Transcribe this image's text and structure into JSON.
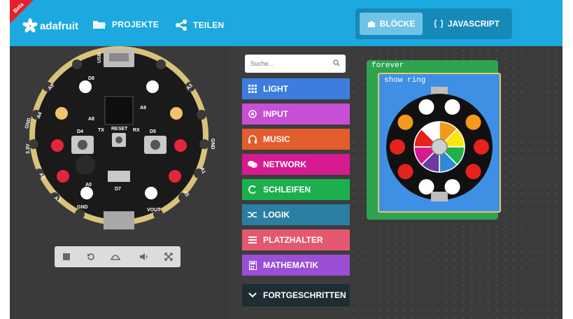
{
  "header": {
    "badge": "Beta",
    "brand": "adafruit",
    "projects_label": "PROJEKTE",
    "share_label": "TEILEN",
    "blocks_label": "BLÖCKE",
    "javascript_label": "JAVASCRIPT"
  },
  "colors": {
    "header": "#1ca9e0",
    "blocks_tab": "#6ec4e6",
    "workspace": "#3b3b3b"
  },
  "simulator": {
    "board_labels": {
      "d8": "D8",
      "d4": "D4",
      "d5": "D5",
      "tx": "TX",
      "rx": "RX",
      "reset": "RESET",
      "a9": "A9",
      "a8": "A8",
      "a0": "A0",
      "d7": "D7",
      "gnd_left": "GND",
      "gnd_right": "GND",
      "vout": "VOUT",
      "gnd_bottom": "GND",
      "p33v": "3.3V",
      "a1": "A1",
      "a2": "A2",
      "a3": "A3",
      "a4": "A4",
      "a5": "A5",
      "a6": "A6",
      "a7": "A7",
      "usb": "USB"
    },
    "controls": [
      "stop-icon",
      "restart-icon",
      "slow-motion-icon",
      "mute-icon",
      "fullscreen-icon"
    ]
  },
  "toolbox": {
    "search_placeholder": "Suche...",
    "categories": [
      {
        "label": "LIGHT",
        "color": "#3d7de0",
        "icon": "grid-icon"
      },
      {
        "label": "INPUT",
        "color": "#c64fd6",
        "icon": "target-icon"
      },
      {
        "label": "MUSIC",
        "color": "#e35d2d",
        "icon": "headphones-icon"
      },
      {
        "label": "NETWORK",
        "color": "#d61a90",
        "icon": "chat-icon"
      },
      {
        "label": "SCHLEIFEN",
        "color": "#1bb04d",
        "icon": "loop-icon"
      },
      {
        "label": "LOGIK",
        "color": "#2a7fa2",
        "icon": "shuffle-icon"
      },
      {
        "label": "PLATZHALTER",
        "color": "#e4586f",
        "icon": "list-icon"
      },
      {
        "label": "MATHEMATIK",
        "color": "#9a4fd6",
        "icon": "calculator-icon"
      },
      {
        "label": "FORTGESCHRITTEN",
        "color": "#1e2d34",
        "icon": "chevron-down-icon"
      }
    ]
  },
  "workspace": {
    "forever_label": "forever",
    "show_ring_label": "show ring",
    "ring_colors": [
      "#ffffff",
      "#ffffff",
      "#f39a1c",
      "#f39a1c",
      "#e4231e",
      "#e4231e",
      "#e4231e",
      "#e4231e",
      "#ffffff",
      "#ffffff"
    ],
    "wheel_colors": [
      "#f39a1c",
      "#f8e60e",
      "#1fb14a",
      "#2c8bd6",
      "#6b3aa0",
      "#d61a90",
      "#e4231e",
      "#ffffff"
    ]
  }
}
